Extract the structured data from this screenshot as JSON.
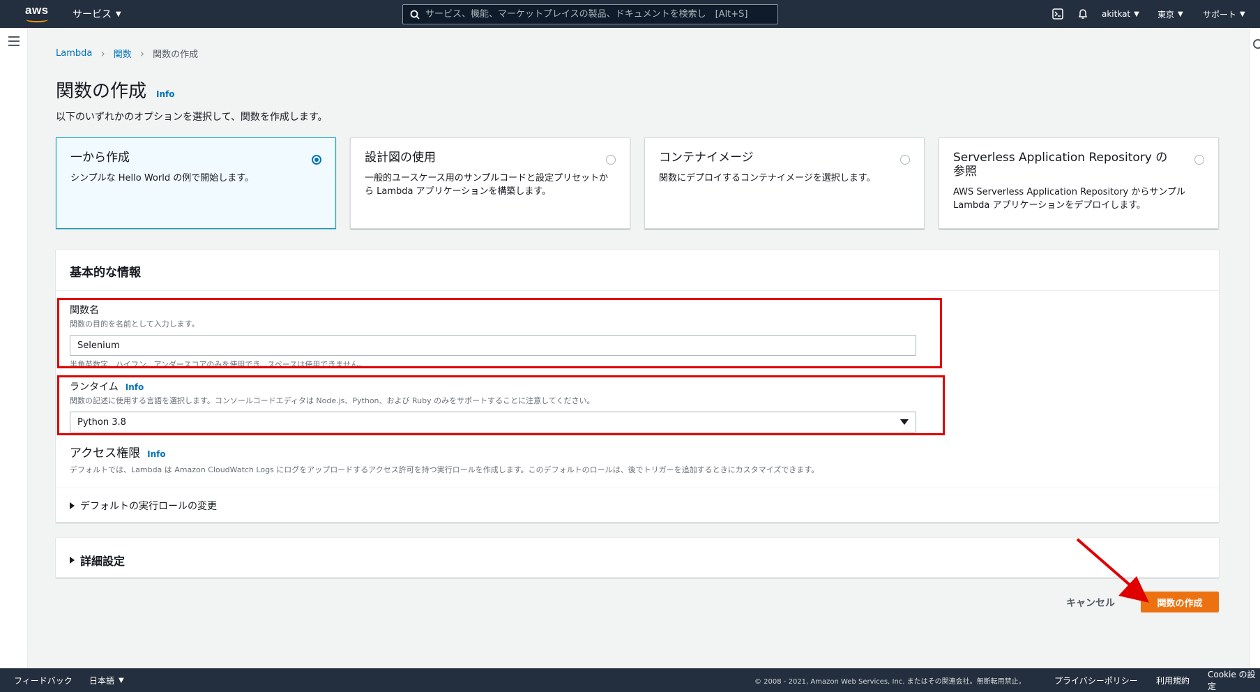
{
  "nav": {
    "logo_text": "aws",
    "services": "サービス",
    "search_placeholder": "サービス、機能、マーケットプレイスの製品、ドキュメントを検索し　[Alt+S]",
    "user": "akitkat",
    "region": "東京",
    "support": "サポート"
  },
  "breadcrumb": {
    "items": [
      "Lambda",
      "関数"
    ],
    "current": "関数の作成"
  },
  "page": {
    "title": "関数の作成",
    "info": "Info",
    "subtitle": "以下のいずれかのオプションを選択して、関数を作成します。"
  },
  "options": [
    {
      "title": "一から作成",
      "desc": "シンプルな Hello World の例で開始します。",
      "selected": true
    },
    {
      "title": "設計図の使用",
      "desc": "一般的ユースケース用のサンプルコードと設定プリセットから Lambda アプリケーションを構築します。",
      "selected": false
    },
    {
      "title": "コンテナイメージ",
      "desc": "関数にデプロイするコンテナイメージを選択します。",
      "selected": false
    },
    {
      "title": "Serverless Application Repository の参照",
      "desc": "AWS Serverless Application Repository からサンプル Lambda アプリケーションをデプロイします。",
      "selected": false
    }
  ],
  "basic": {
    "header": "基本的な情報",
    "function_name": {
      "label": "関数名",
      "desc": "関数の目的を名前として入力します。",
      "value": "Selenium",
      "constraint": "半角英数字、ハイフン、アンダースコアのみを使用でき、スペースは使用できません。"
    },
    "runtime": {
      "label": "ランタイム",
      "info": "Info",
      "desc": "関数の記述に使用する言語を選択します。コンソールコードエディタは Node.js、Python、および Ruby のみをサポートすることに注意してください。",
      "value": "Python 3.8"
    },
    "permissions": {
      "label": "アクセス権限",
      "info": "Info",
      "desc": "デフォルトでは、Lambda は Amazon CloudWatch Logs にログをアップロードするアクセス許可を持つ実行ロールを作成します。このデフォルトのロールは、後でトリガーを追加するときにカスタマイズできます。",
      "expander": "デフォルトの実行ロールの変更"
    }
  },
  "advanced": {
    "label": "詳細設定"
  },
  "actions": {
    "cancel": "キャンセル",
    "create": "関数の作成"
  },
  "footer": {
    "feedback": "フィードバック",
    "language": "日本語",
    "copyright": "© 2008 - 2021, Amazon Web Services, Inc. またはその関連会社。無断転用禁止。",
    "privacy": "プライバシーポリシー",
    "terms": "利用規約",
    "cookie": "Cookie の設定"
  },
  "colors": {
    "nav_bg": "#232f3e",
    "primary": "#ec7211",
    "link": "#0073bb",
    "highlight": "#e00000"
  }
}
